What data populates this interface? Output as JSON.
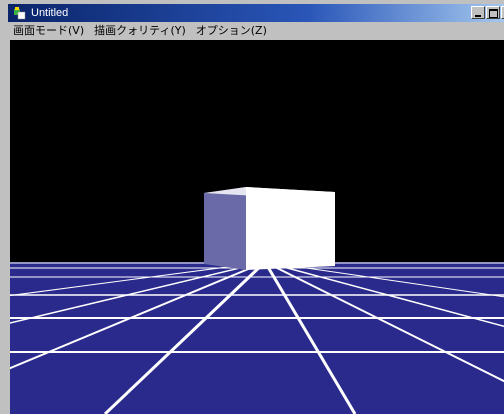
{
  "window": {
    "title": "Untitled"
  },
  "menu": {
    "items": [
      {
        "label": "画面モード(V)"
      },
      {
        "label": "描画クォリティ(Y)"
      },
      {
        "label": "オプション(Z)"
      }
    ]
  },
  "scene": {
    "background_color": "#000000",
    "floor_color": "#2a2a8c",
    "grid_line_color": "#ffffff",
    "cube_front_color": "#ffffff",
    "cube_side_color": "#6a6aa8"
  },
  "icons": {
    "app_icon": "app-icon",
    "minimize": "minimize-icon",
    "maximize": "maximize-icon",
    "close": "close-icon"
  }
}
